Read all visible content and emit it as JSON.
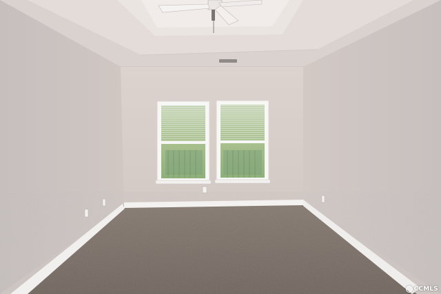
{
  "scene": {
    "description_free": true,
    "watermark": "CCMLS",
    "colors": {
      "wall_left": "#c8c0bd",
      "wall_right": "#cbc3c0",
      "wall_back": "#d6ccc8",
      "ceiling": "#d9d2cf",
      "ceiling_tray": "#e2dbd8",
      "carpet": "#7a6e66",
      "baseboard": "#f4f2f0",
      "window_trim": "#f7f7f5",
      "foliage": "#9bb57a"
    },
    "icons": [
      "ceiling-fan-icon",
      "watermark-logo-icon"
    ]
  }
}
